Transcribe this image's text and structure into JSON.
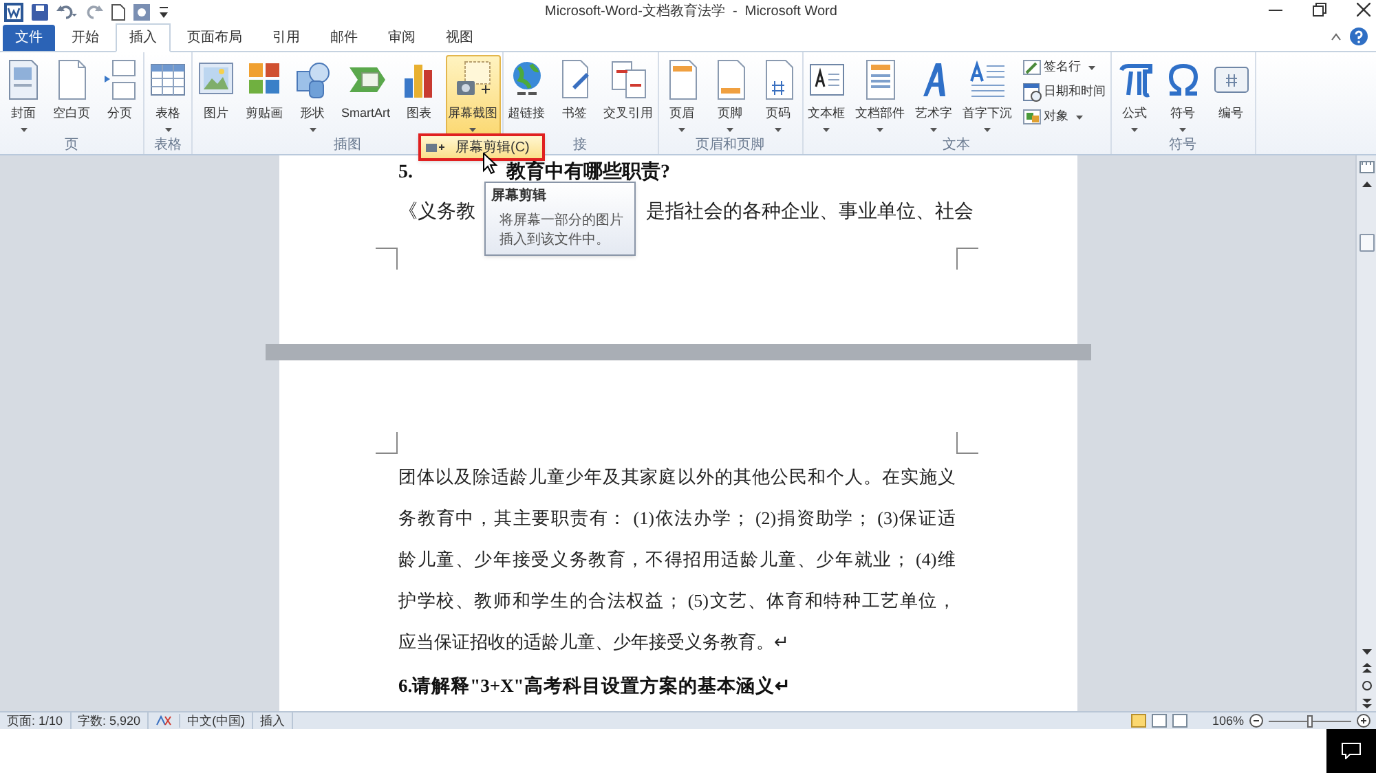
{
  "window": {
    "title": "Microsoft-Word-文档教育法学  -  Microsoft Word"
  },
  "tabs": [
    {
      "label": "文件",
      "kind": "file",
      "selected": false
    },
    {
      "label": "开始",
      "kind": "tab",
      "selected": false
    },
    {
      "label": "插入",
      "kind": "tab",
      "selected": true
    },
    {
      "label": "页面布局",
      "kind": "tab",
      "selected": false
    },
    {
      "label": "引用",
      "kind": "tab",
      "selected": false
    },
    {
      "label": "邮件",
      "kind": "tab",
      "selected": false
    },
    {
      "label": "审阅",
      "kind": "tab",
      "selected": false
    },
    {
      "label": "视图",
      "kind": "tab",
      "selected": false
    }
  ],
  "ribbon": [
    {
      "label": "页",
      "buttons": [
        {
          "label": "封面",
          "kind": "large",
          "dropdown": true,
          "selected": false
        },
        {
          "label": "空白页",
          "kind": "large",
          "dropdown": false,
          "selected": false
        },
        {
          "label": "分页",
          "kind": "large",
          "dropdown": false,
          "selected": false
        }
      ]
    },
    {
      "label": "表格",
      "buttons": [
        {
          "label": "表格",
          "kind": "large",
          "dropdown": true,
          "selected": false
        }
      ]
    },
    {
      "label": "插图",
      "buttons": [
        {
          "label": "图片",
          "kind": "large",
          "dropdown": false,
          "selected": false
        },
        {
          "label": "剪贴画",
          "kind": "large",
          "dropdown": false,
          "selected": false
        },
        {
          "label": "形状",
          "kind": "large",
          "dropdown": true,
          "selected": false
        },
        {
          "label": "SmartArt",
          "kind": "large",
          "dropdown": false,
          "selected": false
        },
        {
          "label": "图表",
          "kind": "large",
          "dropdown": false,
          "selected": false
        },
        {
          "label": "屏幕截图",
          "kind": "large",
          "dropdown": true,
          "selected": true
        }
      ]
    },
    {
      "label": "接",
      "buttons": [
        {
          "label": "超链接",
          "kind": "large",
          "dropdown": false,
          "selected": false
        },
        {
          "label": "书签",
          "kind": "large",
          "dropdown": false,
          "selected": false
        },
        {
          "label": "交叉引用",
          "kind": "large",
          "dropdown": false,
          "selected": false
        }
      ]
    },
    {
      "label": "页眉和页脚",
      "buttons": [
        {
          "label": "页眉",
          "kind": "large",
          "dropdown": true,
          "selected": false
        },
        {
          "label": "页脚",
          "kind": "large",
          "dropdown": true,
          "selected": false
        },
        {
          "label": "页码",
          "kind": "large",
          "dropdown": true,
          "selected": false
        }
      ]
    },
    {
      "label": "文本",
      "buttons": [
        {
          "label": "文本框",
          "kind": "large",
          "dropdown": true,
          "selected": false
        },
        {
          "label": "文档部件",
          "kind": "large",
          "dropdown": true,
          "selected": false
        },
        {
          "label": "艺术字",
          "kind": "large",
          "dropdown": true,
          "selected": false
        },
        {
          "label": "首字下沉",
          "kind": "large",
          "dropdown": true,
          "selected": false
        },
        {
          "label": "签名行",
          "kind": "small",
          "dropdown": true,
          "selected": false
        },
        {
          "label": "日期和时间",
          "kind": "small",
          "dropdown": false,
          "selected": false
        },
        {
          "label": "对象",
          "kind": "small",
          "dropdown": true,
          "selected": false
        }
      ]
    },
    {
      "label": "符号",
      "buttons": [
        {
          "label": "公式",
          "kind": "large",
          "dropdown": true,
          "selected": false
        },
        {
          "label": "符号",
          "kind": "large",
          "dropdown": true,
          "selected": false
        },
        {
          "label": "编号",
          "kind": "large",
          "dropdown": false,
          "selected": false
        }
      ]
    }
  ],
  "dropdown_menu": {
    "items": [
      {
        "label": "屏幕剪辑(C)",
        "selected": true
      }
    ]
  },
  "tooltip": {
    "title": "屏幕剪辑",
    "text": "将屏幕一部分的图片插入到该文件中。"
  },
  "document": {
    "page_1": {
      "heading_start": "5.",
      "heading_end": "教育中有哪些职责?",
      "line_start": "《义务教",
      "line_end": "是指社会的各种企业、事业单位、社会"
    },
    "page_2": {
      "lines": [
        "团体以及除适龄儿童少年及其家庭以外的其他公民和个人。在实施义",
        "务教育中，其主要职责有： (1)依法办学； (2)捐资助学； (3)保证适",
        "龄儿童、少年接受义务教育，不得招用适龄儿童、少年就业； (4)维",
        "护学校、教师和学生的合法权益； (5)文艺、体育和特种工艺单位，",
        "应当保证招收的适龄儿童、少年接受义务教育。↵"
      ],
      "heading": "6.请解释\"3+X\"高考科目设置方案的基本涵义↵"
    }
  },
  "status_bar": {
    "items": [
      "页面: 1/10",
      "字数: 5,920",
      "中文(中国)",
      "插入"
    ],
    "zoom": "106%",
    "zoom_slider": {
      "level": 0.5
    }
  }
}
